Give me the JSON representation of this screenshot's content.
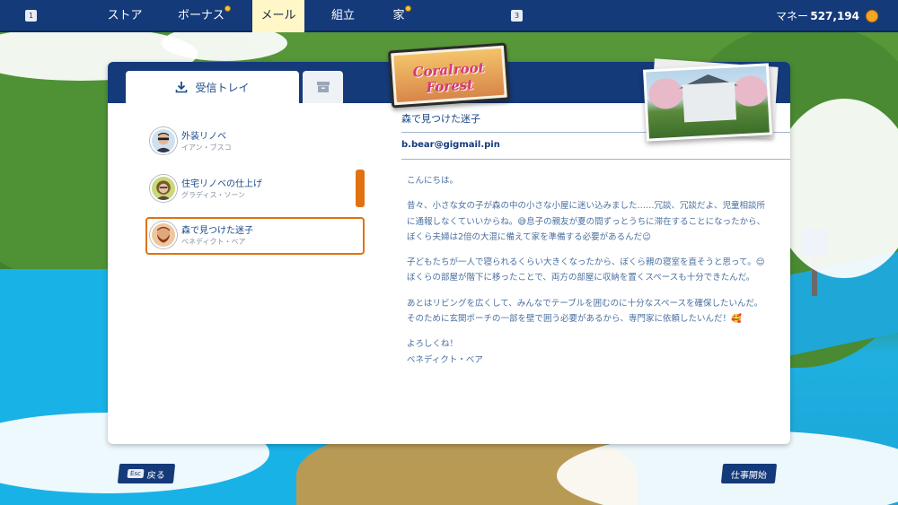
{
  "topbar": {
    "key_left": "1",
    "key_right": "3",
    "nav": [
      {
        "label": "ストア",
        "active": false,
        "dot": false
      },
      {
        "label": "ボーナス",
        "active": false,
        "dot": true
      },
      {
        "label": "メール",
        "active": true,
        "dot": false
      },
      {
        "label": "組立",
        "active": false,
        "dot": false
      },
      {
        "label": "家",
        "active": false,
        "dot": true
      }
    ],
    "money_label": "マネー",
    "money_value": "527,194",
    "coin_icon": "coin-icon"
  },
  "panel": {
    "tab_inbox_label": "受信トレイ",
    "tab_inbox_icon": "download-icon",
    "tab_archive_icon": "archive-box-icon",
    "mails": [
      {
        "subject": "外装リノベ",
        "sender": "イアン・ブスコ",
        "selected": false,
        "avatar": "man-sunglasses-avatar"
      },
      {
        "subject": "住宅リノベの仕上げ",
        "sender": "グラディス・ソーン",
        "selected": false,
        "avatar": "woman-glasses-avatar"
      },
      {
        "subject": "森で見つけた迷子",
        "sender": "ベネディクト・ベア",
        "selected": true,
        "avatar": "bearded-man-avatar"
      }
    ],
    "detail": {
      "title": "森で見つけた迷子",
      "from": "b.bear@gigmail.pin",
      "paragraphs": [
        "こんにちは。",
        "昔々、小さな女の子が森の中の小さな小屋に迷い込みました……冗談、冗談だよ、児童相談所に通報しなくていいからね。😅息子の親友が夏の間ずっとうちに滞在することになったから、ぼくら夫婦は2倍の大混に備えて家を準備する必要があるんだ😉",
        "子どもたちが一人で寝られるくらい大きくなったから、ぼくら親の寝室を直そうと思って。😌ぼくらの部屋が階下に移ったことで、両方の部屋に収納を置くスペースも十分できたんだ。",
        "あとはリビングを広くして、みんなでテーブルを囲むのに十分なスペースを確保したいんだ。そのために玄関ポーチの一部を壁で囲う必要があるから、専門家に依頼したいんだ！🥰",
        "よろしくね！\nベネディクト・ベア"
      ]
    }
  },
  "logo_text": "Coralroot Forest",
  "buttons": {
    "back_key": "Esc",
    "back_label": "戻る",
    "start_label": "仕事開始"
  }
}
